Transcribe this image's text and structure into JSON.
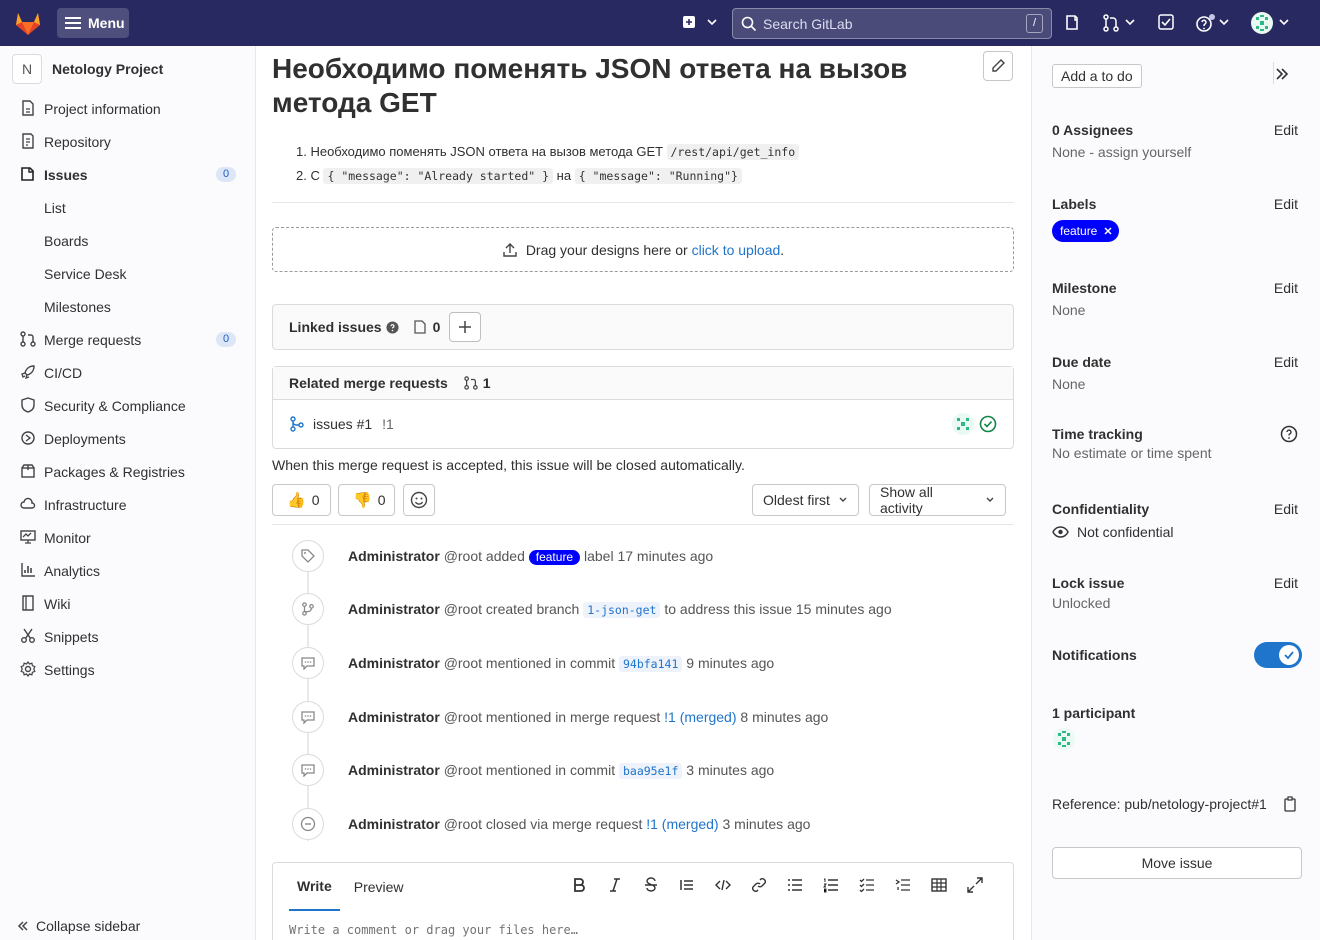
{
  "topbar": {
    "menu_label": "Menu",
    "search_placeholder": "Search GitLab",
    "search_shortcut": "/"
  },
  "sidebar": {
    "project_initial": "N",
    "project_name": "Netology Project",
    "items": [
      {
        "label": "Project information",
        "icon": "info-icon"
      },
      {
        "label": "Repository",
        "icon": "doc-icon"
      },
      {
        "label": "Issues",
        "icon": "issues-icon",
        "badge": "0"
      },
      {
        "label": "List"
      },
      {
        "label": "Boards"
      },
      {
        "label": "Service Desk"
      },
      {
        "label": "Milestones"
      },
      {
        "label": "Merge requests",
        "icon": "merge-icon",
        "badge": "0"
      },
      {
        "label": "CI/CD",
        "icon": "rocket-icon"
      },
      {
        "label": "Security & Compliance",
        "icon": "shield-icon"
      },
      {
        "label": "Deployments",
        "icon": "deploy-icon"
      },
      {
        "label": "Packages & Registries",
        "icon": "package-icon"
      },
      {
        "label": "Infrastructure",
        "icon": "cloud-icon"
      },
      {
        "label": "Monitor",
        "icon": "monitor-icon"
      },
      {
        "label": "Analytics",
        "icon": "chart-icon"
      },
      {
        "label": "Wiki",
        "icon": "book-icon"
      },
      {
        "label": "Snippets",
        "icon": "scissors-icon"
      },
      {
        "label": "Settings",
        "icon": "gear-icon"
      }
    ],
    "collapse_label": "Collapse sidebar"
  },
  "issue": {
    "title": "Необходимо поменять JSON ответа на вызов метода GET",
    "desc_1_prefix": "1. Необходимо поменять JSON ответа на вызов метода GET",
    "desc_1_code": "/rest/api/get_info",
    "desc_2_prefix": "2. С",
    "desc_2_code_a": "{ \"message\": \"Already started\" }",
    "desc_2_mid": "на",
    "desc_2_code_b": "{ \"message\": \"Running\"}",
    "drop_text": "Drag your designs here or",
    "drop_link": "click to upload",
    "drop_end": ".",
    "linked_title": "Linked issues",
    "linked_count": "0",
    "related_title": "Related merge requests",
    "related_count": "1",
    "mr_name": "issues #1",
    "mr_ref": "!1",
    "close_note": "When this merge request is accepted, this issue will be closed automatically.",
    "thumbs_up_count": "0",
    "thumbs_down_count": "0",
    "sort_label": "Oldest first",
    "filter_label": "Show all activity"
  },
  "timeline": [
    {
      "author": "Administrator",
      "handle": "@root",
      "pre": "added",
      "label": "feature",
      "post": "label 17 minutes ago",
      "icon": "tag-icon"
    },
    {
      "author": "Administrator",
      "handle": "@root",
      "pre": "created branch",
      "code": "1-json-get",
      "post": "to address this issue 15 minutes ago",
      "icon": "branch-icon"
    },
    {
      "author": "Administrator",
      "handle": "@root",
      "pre": "mentioned in commit",
      "code": "94bfa141",
      "post": "9 minutes ago",
      "icon": "comment-icon"
    },
    {
      "author": "Administrator",
      "handle": "@root",
      "pre": "mentioned in merge request",
      "link": "!1 (merged)",
      "post": "8 minutes ago",
      "icon": "comment-icon"
    },
    {
      "author": "Administrator",
      "handle": "@root",
      "pre": "mentioned in commit",
      "code": "baa95e1f",
      "post": "3 minutes ago",
      "icon": "comment-icon"
    },
    {
      "author": "Administrator",
      "handle": "@root",
      "pre": "closed via merge request",
      "link": "!1 (merged)",
      "post": "3 minutes ago",
      "icon": "minus-circle-icon"
    }
  ],
  "editor": {
    "tab_write": "Write",
    "tab_preview": "Preview",
    "placeholder": "Write a comment or drag your files here…"
  },
  "right": {
    "todo_label": "Add a to do",
    "edit_label": "Edit",
    "assignees_title": "0 Assignees",
    "assignees_value": "None - assign yourself",
    "labels_title": "Labels",
    "label_name": "feature",
    "milestone_title": "Milestone",
    "milestone_value": "None",
    "due_title": "Due date",
    "due_value": "None",
    "time_title": "Time tracking",
    "time_value": "No estimate or time spent",
    "conf_title": "Confidentiality",
    "conf_value": "Not confidential",
    "lock_title": "Lock issue",
    "lock_value": "Unlocked",
    "notif_title": "Notifications",
    "participants_title": "1 participant",
    "reference": "Reference: pub/netology-project#1",
    "move_label": "Move issue"
  },
  "colors": {
    "topbar": "#292961",
    "label_blue": "#0000ff",
    "link": "#1f75cb",
    "success": "#108548"
  }
}
